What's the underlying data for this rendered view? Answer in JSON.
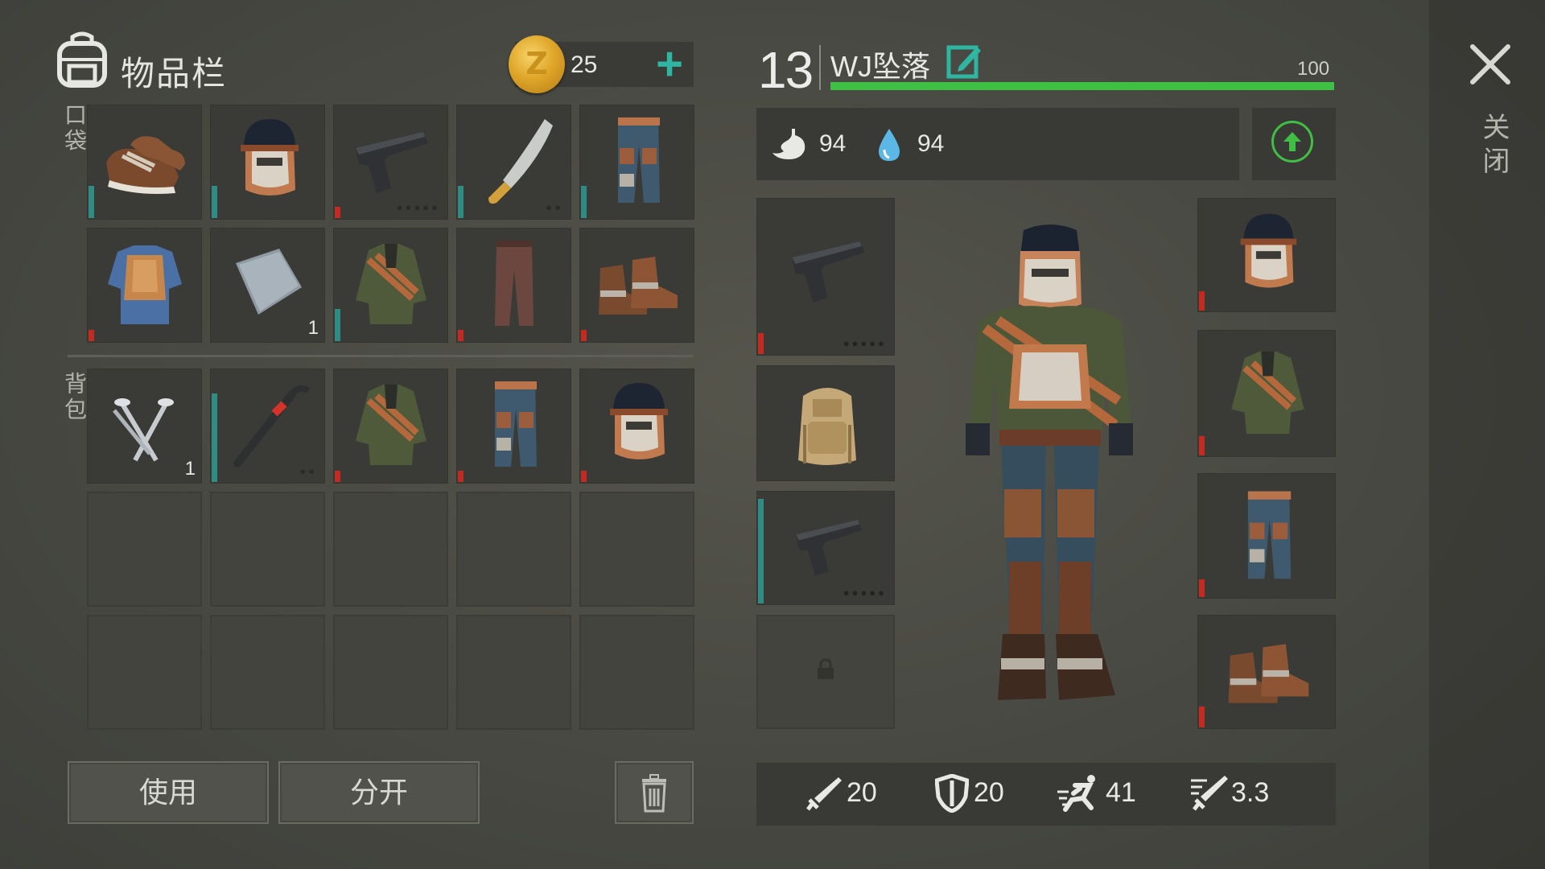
{
  "inventory": {
    "title": "物品栏",
    "coins": "25",
    "pockets_label": "口袋",
    "backpack_label": "背包",
    "pocket_slots": [
      {
        "item": "sneakers",
        "durability": "teal"
      },
      {
        "item": "welding-helmet",
        "durability": "teal"
      },
      {
        "item": "pistol",
        "durability": "red",
        "dots": "●●●●●"
      },
      {
        "item": "machete",
        "durability": "teal",
        "dots": "●●"
      },
      {
        "item": "armored-pants",
        "durability": "teal"
      },
      {
        "item": "armored-vest",
        "durability": "red"
      },
      {
        "item": "metal-plate",
        "quantity": "1"
      },
      {
        "item": "camo-jacket",
        "durability": "teal"
      },
      {
        "item": "brown-pants",
        "durability": "red"
      },
      {
        "item": "brown-boots",
        "durability": "red"
      }
    ],
    "backpack_slots": [
      {
        "item": "nails",
        "quantity": "1"
      },
      {
        "item": "crowbar",
        "durability": "teal",
        "dots": "●●"
      },
      {
        "item": "camo-jacket",
        "durability": "red"
      },
      {
        "item": "armored-pants",
        "durability": "red"
      },
      {
        "item": "welding-helmet",
        "durability": "red"
      }
    ]
  },
  "buttons": {
    "use": "使用",
    "split": "分开",
    "delete_icon": "trash-icon"
  },
  "character": {
    "level": "13",
    "name": "WJ坠落",
    "hp_max": "100",
    "hp_fraction": 1.0,
    "hunger": "94",
    "thirst": "94",
    "stats": {
      "attack": "20",
      "defense": "20",
      "speed": "41",
      "attack_speed": "3.3"
    },
    "equipment_left": [
      "pistol",
      "backpack",
      "pistol",
      "locked"
    ],
    "equipment_right": [
      "welding-helmet",
      "camo-jacket",
      "armored-pants",
      "brown-boots"
    ]
  },
  "close_label": "关闭",
  "colors": {
    "hp": "#3fbf43",
    "accent_teal": "#2fb6a2",
    "durability_red": "#c42a22",
    "durability_teal": "#2e8c84"
  }
}
